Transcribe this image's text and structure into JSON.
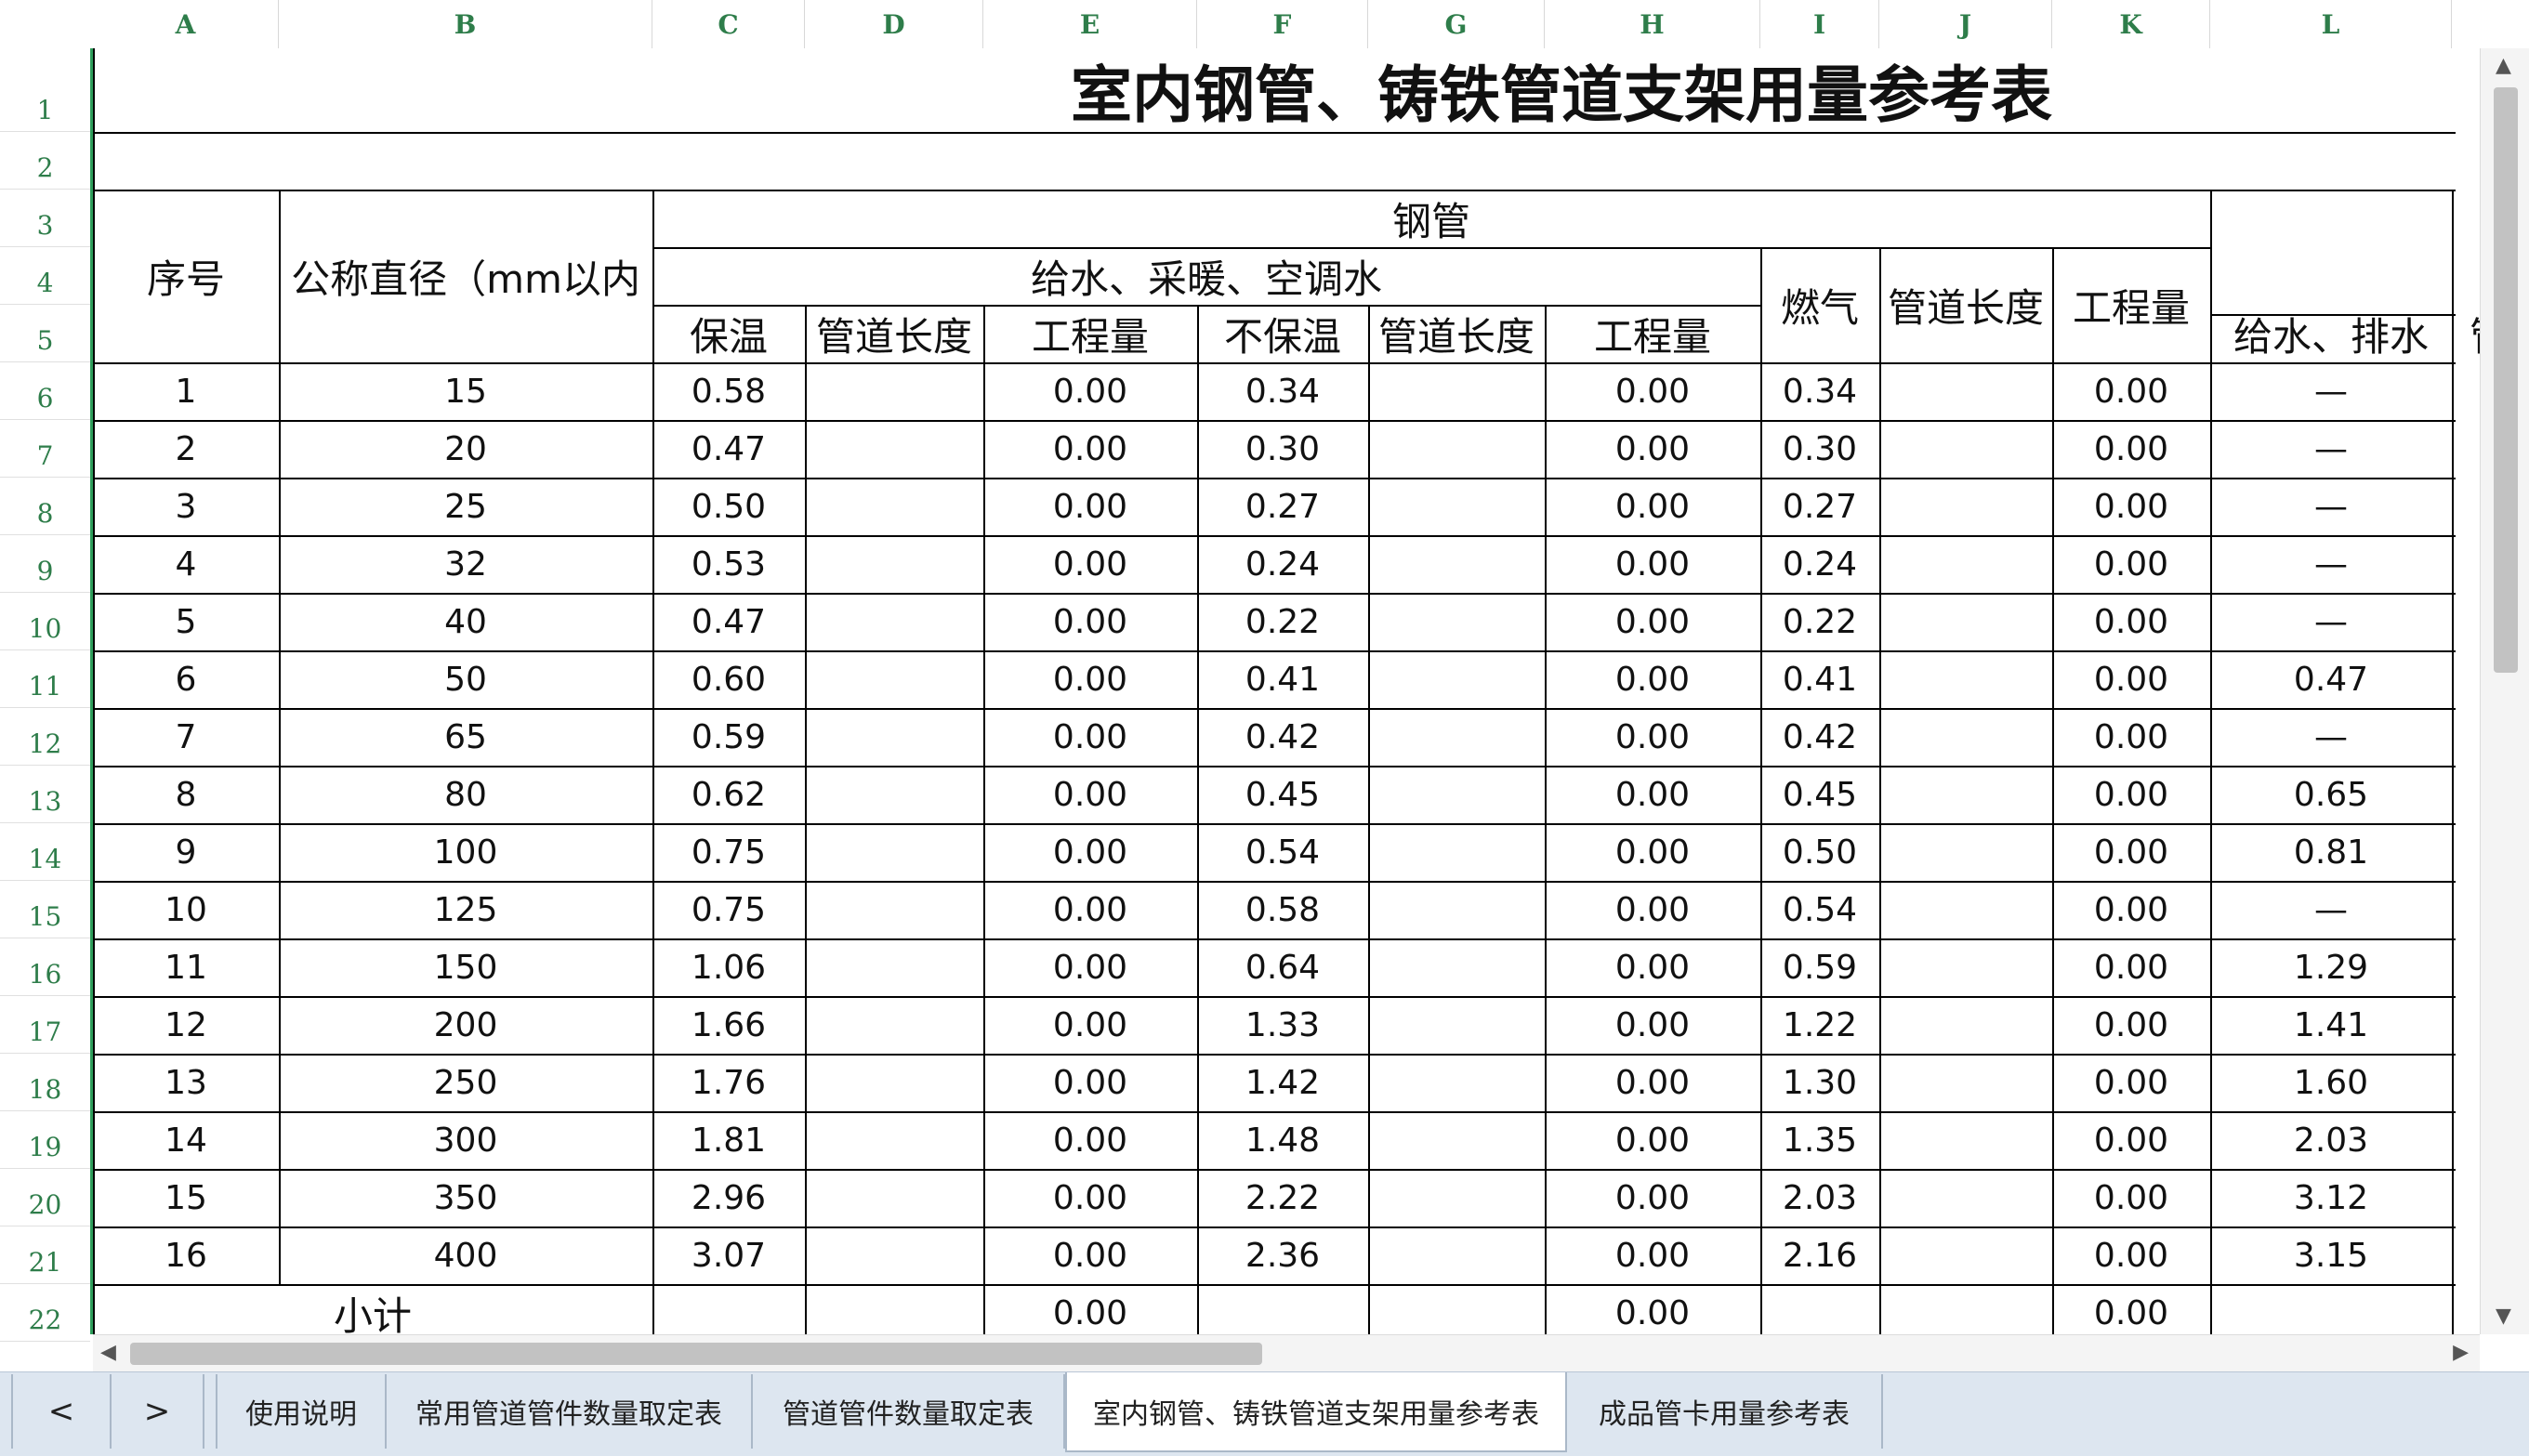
{
  "columns": [
    "A",
    "B",
    "C",
    "D",
    "E",
    "F",
    "G",
    "H",
    "I",
    "J",
    "K",
    "L"
  ],
  "rows": [
    "1",
    "2",
    "3",
    "4",
    "5",
    "6",
    "7",
    "8",
    "9",
    "10",
    "11",
    "12",
    "13",
    "14",
    "15",
    "16",
    "17",
    "18",
    "19",
    "20",
    "21",
    "22"
  ],
  "title": "室内钢管、铸铁管道支架用量参考表",
  "headers": {
    "seq": "序号",
    "diameter": "公称直径（mm以内",
    "steel": "钢管",
    "water": "给水、采暖、空调水",
    "insulated": "保温",
    "pipe_len_1": "管道长度",
    "qty_1": "工程量",
    "uninsulated": "不保温",
    "pipe_len_2": "管道长度",
    "qty_2": "工程量",
    "gas": "燃气",
    "pipe_len_3": "管道长度",
    "qty_3": "工程量",
    "drain": "给水、排水",
    "next_partial": "管"
  },
  "table_rows": [
    {
      "seq": "1",
      "dn": "15",
      "ins": "0.58",
      "q1": "0.00",
      "unins": "0.34",
      "q2": "0.00",
      "gas": "0.34",
      "q3": "0.00",
      "drain": "—"
    },
    {
      "seq": "2",
      "dn": "20",
      "ins": "0.47",
      "q1": "0.00",
      "unins": "0.30",
      "q2": "0.00",
      "gas": "0.30",
      "q3": "0.00",
      "drain": "—"
    },
    {
      "seq": "3",
      "dn": "25",
      "ins": "0.50",
      "q1": "0.00",
      "unins": "0.27",
      "q2": "0.00",
      "gas": "0.27",
      "q3": "0.00",
      "drain": "—"
    },
    {
      "seq": "4",
      "dn": "32",
      "ins": "0.53",
      "q1": "0.00",
      "unins": "0.24",
      "q2": "0.00",
      "gas": "0.24",
      "q3": "0.00",
      "drain": "—"
    },
    {
      "seq": "5",
      "dn": "40",
      "ins": "0.47",
      "q1": "0.00",
      "unins": "0.22",
      "q2": "0.00",
      "gas": "0.22",
      "q3": "0.00",
      "drain": "—"
    },
    {
      "seq": "6",
      "dn": "50",
      "ins": "0.60",
      "q1": "0.00",
      "unins": "0.41",
      "q2": "0.00",
      "gas": "0.41",
      "q3": "0.00",
      "drain": "0.47"
    },
    {
      "seq": "7",
      "dn": "65",
      "ins": "0.59",
      "q1": "0.00",
      "unins": "0.42",
      "q2": "0.00",
      "gas": "0.42",
      "q3": "0.00",
      "drain": "—"
    },
    {
      "seq": "8",
      "dn": "80",
      "ins": "0.62",
      "q1": "0.00",
      "unins": "0.45",
      "q2": "0.00",
      "gas": "0.45",
      "q3": "0.00",
      "drain": "0.65"
    },
    {
      "seq": "9",
      "dn": "100",
      "ins": "0.75",
      "q1": "0.00",
      "unins": "0.54",
      "q2": "0.00",
      "gas": "0.50",
      "q3": "0.00",
      "drain": "0.81"
    },
    {
      "seq": "10",
      "dn": "125",
      "ins": "0.75",
      "q1": "0.00",
      "unins": "0.58",
      "q2": "0.00",
      "gas": "0.54",
      "q3": "0.00",
      "drain": "—"
    },
    {
      "seq": "11",
      "dn": "150",
      "ins": "1.06",
      "q1": "0.00",
      "unins": "0.64",
      "q2": "0.00",
      "gas": "0.59",
      "q3": "0.00",
      "drain": "1.29"
    },
    {
      "seq": "12",
      "dn": "200",
      "ins": "1.66",
      "q1": "0.00",
      "unins": "1.33",
      "q2": "0.00",
      "gas": "1.22",
      "q3": "0.00",
      "drain": "1.41"
    },
    {
      "seq": "13",
      "dn": "250",
      "ins": "1.76",
      "q1": "0.00",
      "unins": "1.42",
      "q2": "0.00",
      "gas": "1.30",
      "q3": "0.00",
      "drain": "1.60"
    },
    {
      "seq": "14",
      "dn": "300",
      "ins": "1.81",
      "q1": "0.00",
      "unins": "1.48",
      "q2": "0.00",
      "gas": "1.35",
      "q3": "0.00",
      "drain": "2.03"
    },
    {
      "seq": "15",
      "dn": "350",
      "ins": "2.96",
      "q1": "0.00",
      "unins": "2.22",
      "q2": "0.00",
      "gas": "2.03",
      "q3": "0.00",
      "drain": "3.12"
    },
    {
      "seq": "16",
      "dn": "400",
      "ins": "3.07",
      "q1": "0.00",
      "unins": "2.36",
      "q2": "0.00",
      "gas": "2.16",
      "q3": "0.00",
      "drain": "3.15"
    }
  ],
  "subtotal": {
    "label": "小计",
    "q1": "0.00",
    "q2": "0.00",
    "q3": "0.00"
  },
  "tabs": {
    "prev": "<",
    "next": ">",
    "items": [
      "使用说明",
      "常用管道管件数量取定表",
      "管道管件数量取定表",
      "室内钢管、铸铁管道支架用量参考表",
      "成品管卡用量参考表"
    ],
    "active_index": 3
  },
  "scroll_arrows": {
    "up": "▲",
    "down": "▼",
    "left": "◀",
    "right": "▶"
  },
  "colors": {
    "header_green": "#2e7d4a",
    "tab_bar": "#dde6f0",
    "grid_line": "#000000"
  }
}
